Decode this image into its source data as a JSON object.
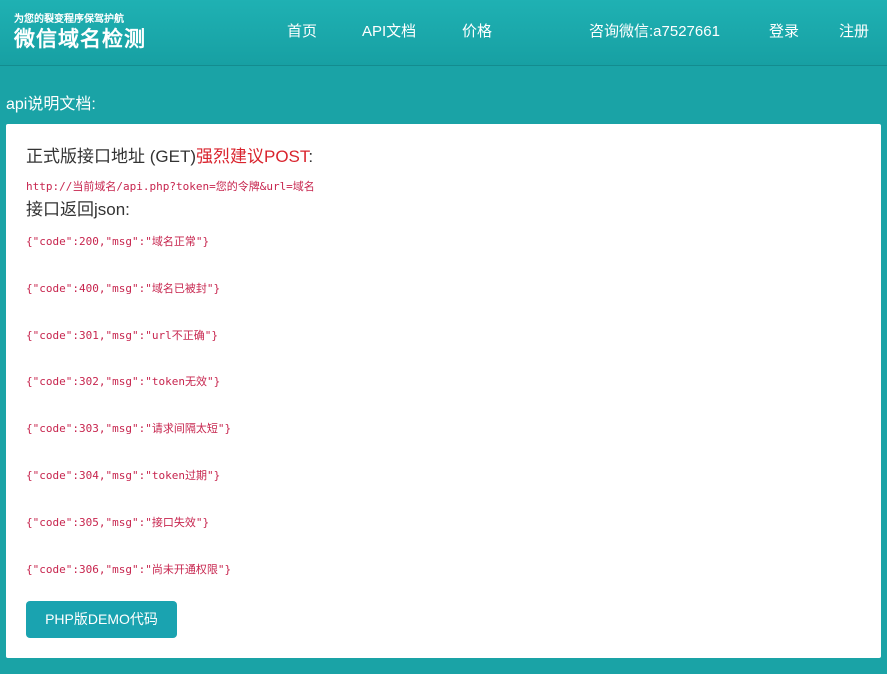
{
  "header": {
    "tagline": "为您的裂变程序保驾护航",
    "brand_title": "微信域名检测",
    "nav": {
      "home": "首页",
      "api_docs": "API文档",
      "price": "价格",
      "contact": "咨询微信:a7527661",
      "login": "登录",
      "register": "注册"
    }
  },
  "page": {
    "section_title": "api说明文档:",
    "endpoint_heading": "正式版接口地址 (GET)",
    "endpoint_warning": "强烈建议POST",
    "endpoint_colon": ":",
    "endpoint_url": "http://当前域名/api.php?token=您的令牌&url=域名",
    "response_heading": "接口返回json:",
    "responses": [
      "{\"code\":200,\"msg\":\"域名正常\"}",
      "{\"code\":400,\"msg\":\"域名已被封\"}",
      "{\"code\":301,\"msg\":\"url不正确\"}",
      "{\"code\":302,\"msg\":\"token无效\"}",
      "{\"code\":303,\"msg\":\"请求间隔太短\"}",
      "{\"code\":304,\"msg\":\"token过期\"}",
      "{\"code\":305,\"msg\":\"接口失效\"}",
      "{\"code\":306,\"msg\":\"尚未开通权限\"}"
    ],
    "demo_button": "PHP版DEMO代码"
  },
  "colors": {
    "header_bg": "#1aa3a6",
    "accent_button": "#1aa3b0",
    "warning_text": "#d9232d",
    "code_text": "#c7254e"
  }
}
